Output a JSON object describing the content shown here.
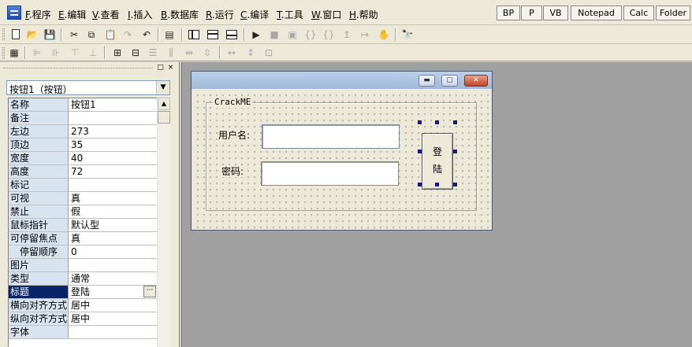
{
  "menu": [
    {
      "key": "F",
      "label": ".程序"
    },
    {
      "key": "E",
      "label": ".编辑"
    },
    {
      "key": "V",
      "label": ".查看"
    },
    {
      "key": "I",
      "label": ".插入"
    },
    {
      "key": "B",
      "label": ".数据库"
    },
    {
      "key": "R",
      "label": ".运行"
    },
    {
      "key": "C",
      "label": ".编译"
    },
    {
      "key": "T",
      "label": ".工具"
    },
    {
      "key": "W",
      "label": ".窗口"
    },
    {
      "key": "H",
      "label": ".帮助"
    }
  ],
  "quick_buttons": [
    "BP",
    "P",
    "VB",
    "Notepad",
    "Calc",
    "Folder"
  ],
  "icons": {
    "new": "new-file-icon",
    "open": "open-folder-icon",
    "save": "save-icon",
    "cut": "cut-icon",
    "copy": "copy-icon",
    "paste": "paste-icon",
    "redo": "redo-icon",
    "undo": "undo-icon",
    "find": "find-icon",
    "run": "run-icon",
    "stop": "stop-icon"
  },
  "panel": {
    "pin_glyph": "□",
    "close_glyph": "×",
    "selected_object": "按钮1（按钮）"
  },
  "properties": [
    {
      "name": "名称",
      "value": "按钮1"
    },
    {
      "name": "备注",
      "value": ""
    },
    {
      "name": "左边",
      "value": "273"
    },
    {
      "name": "顶边",
      "value": "35"
    },
    {
      "name": "宽度",
      "value": "40"
    },
    {
      "name": "高度",
      "value": "72"
    },
    {
      "name": "标记",
      "value": ""
    },
    {
      "name": "可视",
      "value": "真"
    },
    {
      "name": "禁止",
      "value": "假"
    },
    {
      "name": "鼠标指针",
      "value": "默认型"
    },
    {
      "name": "可停留焦点",
      "value": "真"
    },
    {
      "name": "停留顺序",
      "value": "0"
    },
    {
      "name": "图片",
      "value": ""
    },
    {
      "name": "类型",
      "value": "通常"
    },
    {
      "name": "标题",
      "value": "登陆"
    },
    {
      "name": "横向对齐方式",
      "value": "居中"
    },
    {
      "name": "纵向对齐方式",
      "value": "居中"
    },
    {
      "name": "字体",
      "value": ""
    }
  ],
  "form": {
    "group_title": "CrackME",
    "username_label": "用户名:",
    "password_label": "密码:",
    "login_button_line1": "登",
    "login_button_line2": "陆",
    "minimize_glyph": "▬",
    "maximize_glyph": "▢",
    "close_glyph": "✕"
  },
  "colors": {
    "selection": "#0a246a",
    "property_name_bg": "#d7e4f0",
    "design_bg": "#a0a0a0",
    "form_title_gradient": "#b9d1ea",
    "handle": "#1a1a80"
  }
}
